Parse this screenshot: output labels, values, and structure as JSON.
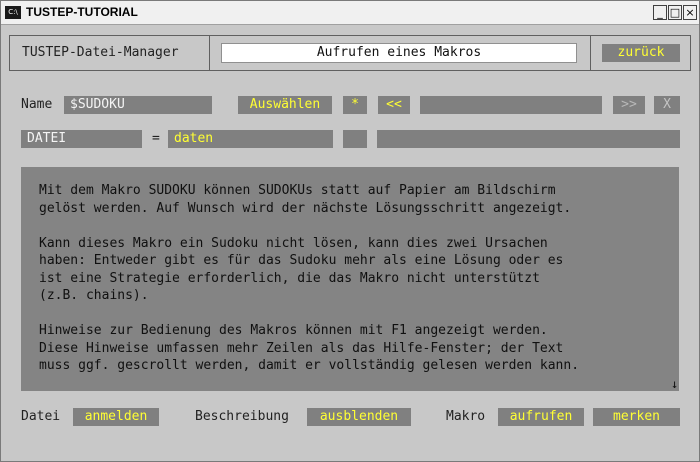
{
  "window": {
    "title": "TUSTEP-TUTORIAL",
    "icon_label": "C:\\",
    "minimize_label": "_",
    "maximize_label": "□",
    "close_label": "×"
  },
  "header": {
    "app_name": "TUSTEP-Datei-Manager",
    "screen_title": "Aufrufen eines Makros",
    "back_label": "zurück"
  },
  "row1": {
    "name_label": "Name",
    "name_value": "$SUDOKU",
    "select_label": "Auswählen",
    "star_label": "*",
    "prev_label": "<<",
    "field_value": "",
    "next_label": ">>",
    "clear_label": "X"
  },
  "row2": {
    "datei_value": "DATEI",
    "equals": "=",
    "daten_value": "daten",
    "small_value": "",
    "long_value": ""
  },
  "description": {
    "text": "Mit dem Makro SUDOKU können SUDOKUs statt auf Papier am Bildschirm\ngelöst werden. Auf Wunsch wird der nächste Lösungsschritt angezeigt.\n\nKann dieses Makro ein Sudoku nicht lösen, kann dies zwei Ursachen\nhaben: Entweder gibt es für das Sudoku mehr als eine Lösung oder es\nist eine Strategie erforderlich, die das Makro nicht unterstützt\n(z.B. chains).\n\nHinweise zur Bedienung des Makros können mit F1 angezeigt werden.\nDiese Hinweise umfassen mehr Zeilen als das Hilfe-Fenster; der Text\nmuss ggf. gescrollt werden, damit er vollständig gelesen werden kann.",
    "scroll_down_icon": "↓"
  },
  "footer": {
    "datei_label": "Datei",
    "anmelden_label": "anmelden",
    "beschreibung_label": "Beschreibung",
    "ausblenden_label": "ausblenden",
    "makro_label": "Makro",
    "aufrufen_label": "aufrufen",
    "merken_label": "merken"
  },
  "colors": {
    "field_gray": "#808080",
    "accent_yellow": "#ffff33",
    "background": "#c8c8c8"
  }
}
